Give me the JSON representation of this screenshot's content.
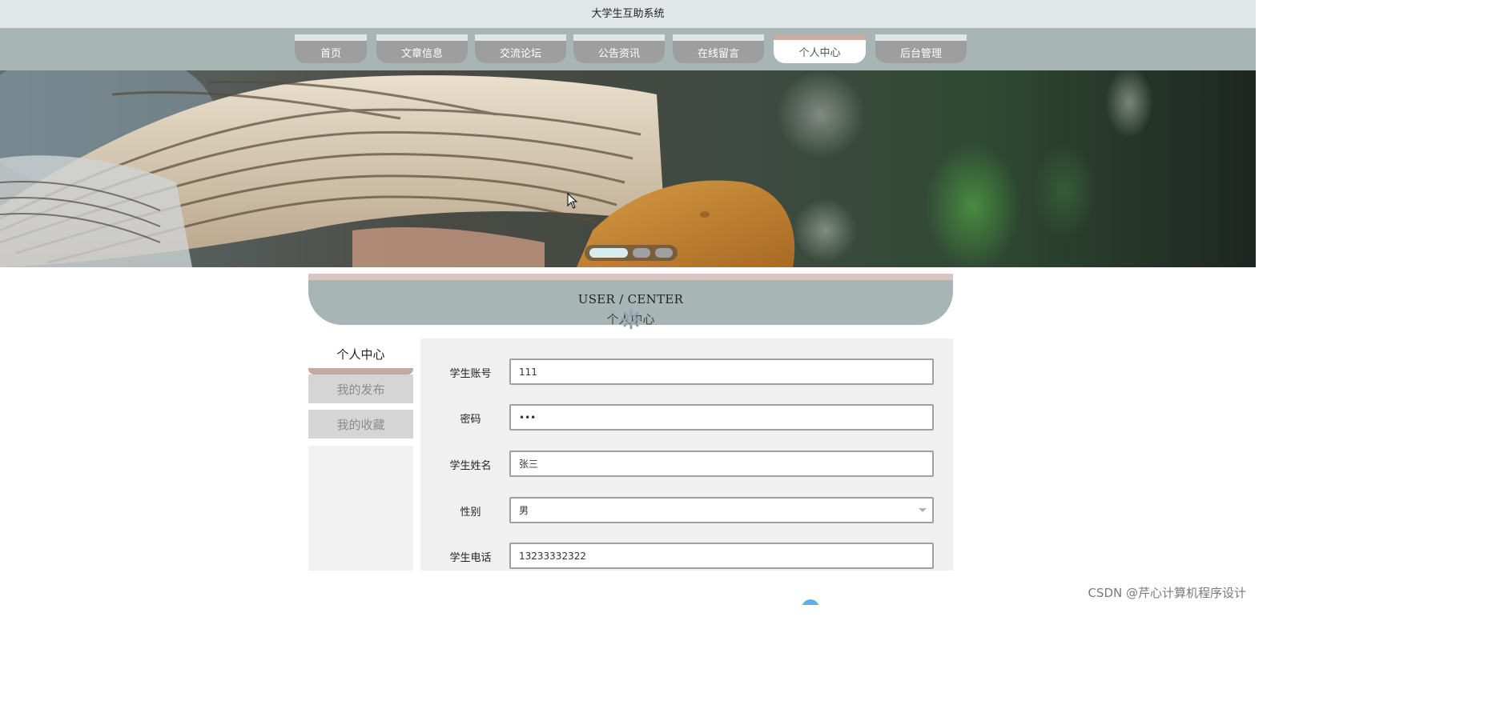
{
  "header": {
    "site_title": "大学生互助系统"
  },
  "nav": {
    "items": [
      {
        "label": "首页",
        "active": false
      },
      {
        "label": "文章信息",
        "active": false
      },
      {
        "label": "交流论坛",
        "active": false
      },
      {
        "label": "公告资讯",
        "active": false
      },
      {
        "label": "在线留言",
        "active": false
      },
      {
        "label": "个人中心",
        "active": true
      },
      {
        "label": "后台管理",
        "active": false
      }
    ]
  },
  "banner": {
    "slide_count": 3,
    "active_slide": 1
  },
  "section": {
    "title_en": "USER / CENTER",
    "title_cn": "个人中心"
  },
  "sidebar": {
    "title": "个人中心",
    "items": [
      {
        "label": "我的发布"
      },
      {
        "label": "我的收藏"
      }
    ]
  },
  "form": {
    "fields": [
      {
        "label": "学生账号",
        "value": "111",
        "type": "text"
      },
      {
        "label": "密码",
        "value": "111",
        "type": "password"
      },
      {
        "label": "学生姓名",
        "value": "张三",
        "type": "text"
      },
      {
        "label": "性别",
        "value": "男",
        "type": "select"
      },
      {
        "label": "学生电话",
        "value": "13233332322",
        "type": "text"
      }
    ]
  },
  "footer": {
    "watermark": "CSDN @芹心计算机程序设计"
  },
  "colors": {
    "nav_bar": "#a7b5b5",
    "nav_item": "#9e9e9e",
    "accent_rose": "#c4a9a1",
    "active_dot": "#d6ecef"
  }
}
